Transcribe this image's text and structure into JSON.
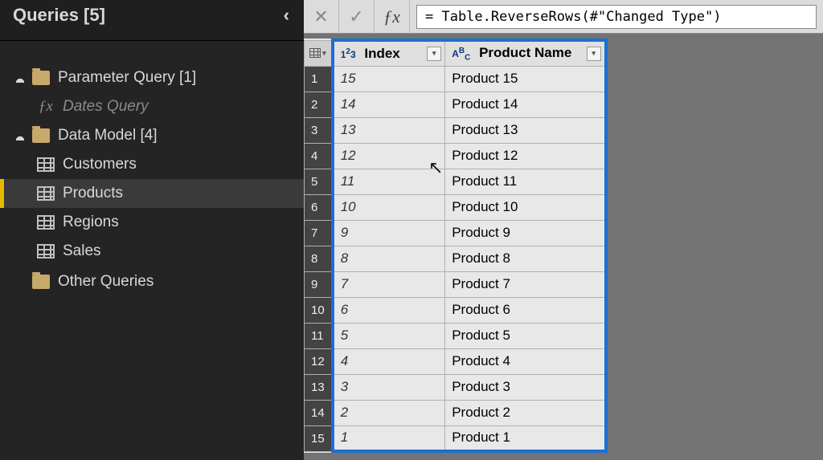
{
  "sidebar": {
    "title": "Queries [5]",
    "groups": [
      {
        "label": "Parameter Query [1]",
        "children": [
          {
            "label": "Dates Query",
            "icon": "fx",
            "kind": "fx"
          }
        ]
      },
      {
        "label": "Data Model [4]",
        "children": [
          {
            "label": "Customers",
            "icon": "table"
          },
          {
            "label": "Products",
            "icon": "table",
            "selected": true
          },
          {
            "label": "Regions",
            "icon": "table"
          },
          {
            "label": "Sales",
            "icon": "table"
          }
        ]
      },
      {
        "label": "Other Queries",
        "children": []
      }
    ]
  },
  "formula_bar": {
    "value": "= Table.ReverseRows(#\"Changed Type\")"
  },
  "columns": [
    {
      "name": "Index",
      "type": "number"
    },
    {
      "name": "Product Name",
      "type": "text"
    }
  ],
  "rows": [
    {
      "Index": 15,
      "Product Name": "Product 15"
    },
    {
      "Index": 14,
      "Product Name": "Product 14"
    },
    {
      "Index": 13,
      "Product Name": "Product 13"
    },
    {
      "Index": 12,
      "Product Name": "Product 12"
    },
    {
      "Index": 11,
      "Product Name": "Product 11"
    },
    {
      "Index": 10,
      "Product Name": "Product 10"
    },
    {
      "Index": 9,
      "Product Name": "Product 9"
    },
    {
      "Index": 8,
      "Product Name": "Product 8"
    },
    {
      "Index": 7,
      "Product Name": "Product 7"
    },
    {
      "Index": 6,
      "Product Name": "Product 6"
    },
    {
      "Index": 5,
      "Product Name": "Product 5"
    },
    {
      "Index": 4,
      "Product Name": "Product 4"
    },
    {
      "Index": 3,
      "Product Name": "Product 3"
    },
    {
      "Index": 2,
      "Product Name": "Product 2"
    },
    {
      "Index": 1,
      "Product Name": "Product 1"
    }
  ]
}
